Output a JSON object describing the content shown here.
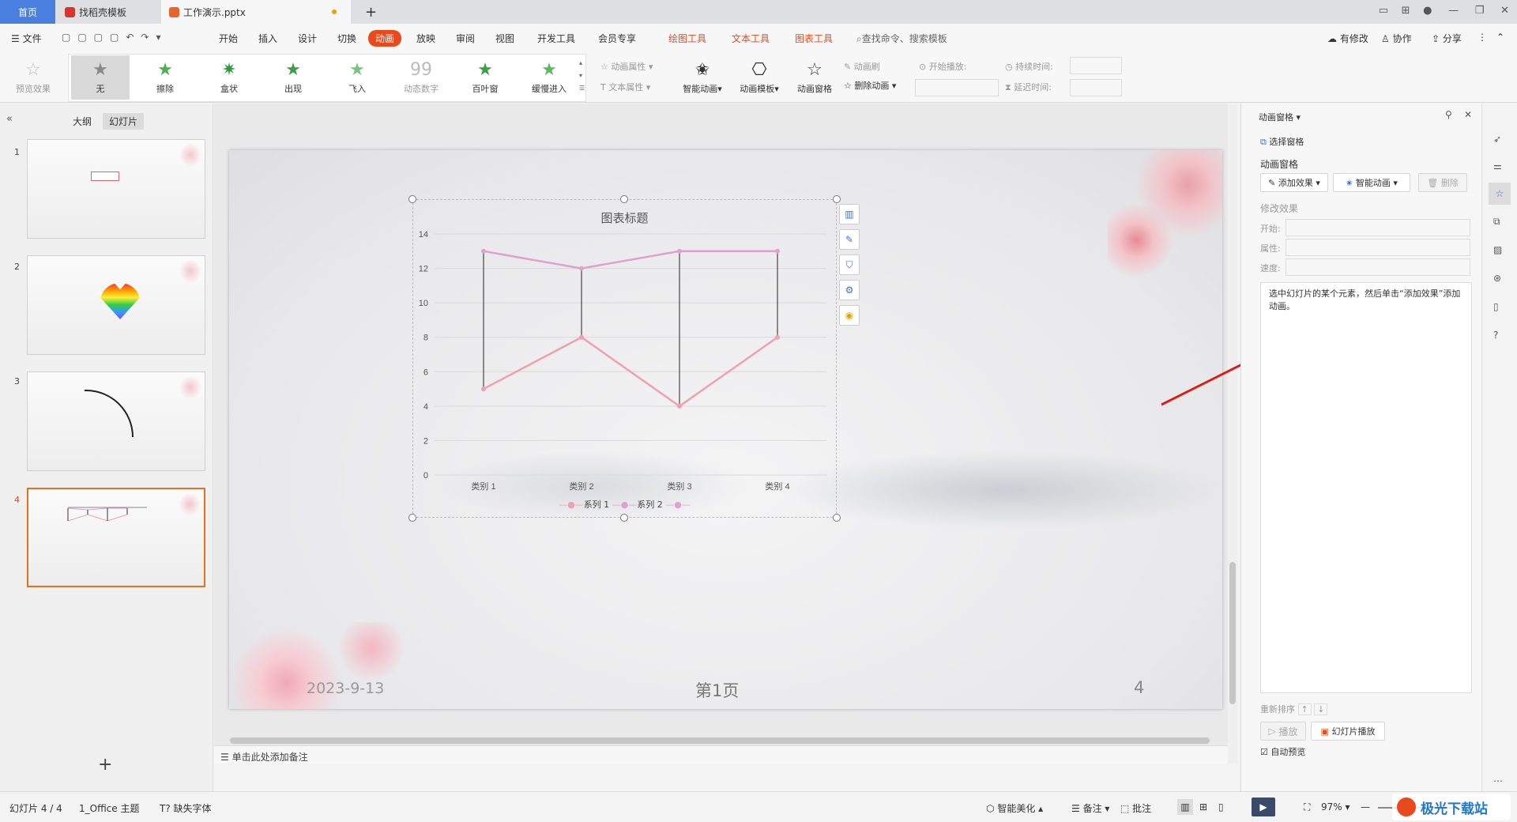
{
  "tabs": {
    "home": "首页",
    "template": "找稻壳模板",
    "doc": "工作演示.pptx",
    "new_tab": "+"
  },
  "menu": {
    "file": "文件",
    "items": [
      "开始",
      "插入",
      "设计",
      "切换",
      "动画",
      "放映",
      "审阅",
      "视图",
      "开发工具",
      "会员专享"
    ],
    "context_tabs": [
      "绘图工具",
      "文本工具",
      "图表工具"
    ],
    "search": "查找命令、搜索模板",
    "has_changes": "有修改",
    "collab": "协作",
    "share": "分享"
  },
  "ribbon": {
    "preview": "预览效果",
    "effects": [
      "无",
      "擦除",
      "盒状",
      "出现",
      "飞入",
      "动态数字",
      "百叶窗",
      "缓慢进入"
    ],
    "anim_attr": "动画属性",
    "text_attr": "文本属性",
    "smart_anim": "智能动画",
    "anim_template": "动画模板",
    "anim_pane": "动画窗格",
    "anim_brush": "动画刷",
    "delete_anim": "删除动画",
    "start_play": "开始播放:",
    "duration": "持续时间:",
    "delay": "延迟时间:"
  },
  "left": {
    "outline": "大纲",
    "slides": "幻灯片",
    "slide_numbers": [
      "1",
      "2",
      "3",
      "4"
    ],
    "add": "+"
  },
  "slide": {
    "chart_title": "图表标题",
    "date": "2023-9-13",
    "page": "第1页",
    "number": "4"
  },
  "chart_data": {
    "type": "line",
    "title": "图表标题",
    "categories": [
      "类别 1",
      "类别 2",
      "类别 3",
      "类别 4"
    ],
    "series": [
      {
        "name": "系列 1",
        "values": [
          5,
          8,
          4,
          8
        ],
        "color": "#f0a0ae"
      },
      {
        "name": "系列 2",
        "values": [
          13,
          12,
          13,
          13
        ],
        "color": "#e0a0d0"
      }
    ],
    "ylim": [
      0,
      14
    ],
    "yticks": [
      "0",
      "2",
      "4",
      "6",
      "8",
      "10",
      "12",
      "14"
    ],
    "legend": "bottom",
    "third_legend_series": "",
    "drop_lines": true
  },
  "notes": "单击此处添加备注",
  "pane": {
    "header": "动画窗格",
    "select_pane": "选择窗格",
    "section": "动画窗格",
    "add_effect": "添加效果",
    "smart_anim": "智能动画",
    "delete": "删除",
    "modify": "修改效果",
    "start": "开始:",
    "property": "属性:",
    "speed": "速度:",
    "hint": "选中幻灯片的某个元素，然后单击“添加效果”添加动画。",
    "reorder": "重新排序",
    "play": "播放",
    "slide_play": "幻灯片播放",
    "auto_preview": "自动预览"
  },
  "status": {
    "slide": "幻灯片 4 / 4",
    "theme": "1_Office 主题",
    "missing_font": "缺失字体",
    "beautify": "智能美化",
    "notes": "备注",
    "comments": "批注",
    "zoom": "97%"
  },
  "watermark": "极光下载站",
  "accent": "#e8491d"
}
